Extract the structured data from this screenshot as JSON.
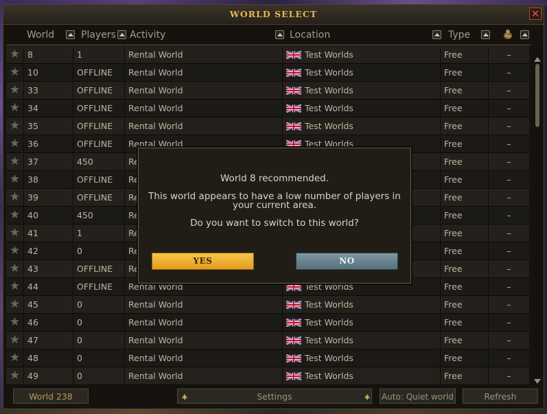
{
  "window": {
    "title": "WORLD SELECT",
    "close_glyph": "✕"
  },
  "columns": {
    "world": "World",
    "players": "Players",
    "activity": "Activity",
    "location": "Location",
    "type": "Type",
    "members_icon": "members-icon"
  },
  "rows": [
    {
      "world": "8",
      "players": "1",
      "activity": "Rental World",
      "location": "Test Worlds",
      "type": "Free",
      "members": "–"
    },
    {
      "world": "10",
      "players": "OFFLINE",
      "activity": "Rental World",
      "location": "Test Worlds",
      "type": "Free",
      "members": "–"
    },
    {
      "world": "33",
      "players": "OFFLINE",
      "activity": "Rental World",
      "location": "Test Worlds",
      "type": "Free",
      "members": "–"
    },
    {
      "world": "34",
      "players": "OFFLINE",
      "activity": "Rental World",
      "location": "Test Worlds",
      "type": "Free",
      "members": "–"
    },
    {
      "world": "35",
      "players": "OFFLINE",
      "activity": "Rental World",
      "location": "Test Worlds",
      "type": "Free",
      "members": "–"
    },
    {
      "world": "36",
      "players": "OFFLINE",
      "activity": "Rental World",
      "location": "Test Worlds",
      "type": "Free",
      "members": "–"
    },
    {
      "world": "37",
      "players": "450",
      "activity": "Re",
      "location": "",
      "type": "Free",
      "members": "–"
    },
    {
      "world": "38",
      "players": "OFFLINE",
      "activity": "Re",
      "location": "",
      "type": "Free",
      "members": "–"
    },
    {
      "world": "39",
      "players": "OFFLINE",
      "activity": "Re",
      "location": "",
      "type": "Free",
      "members": "–"
    },
    {
      "world": "40",
      "players": "450",
      "activity": "Re",
      "location": "",
      "type": "Free",
      "members": "–"
    },
    {
      "world": "41",
      "players": "1",
      "activity": "Re",
      "location": "",
      "type": "Free",
      "members": "–"
    },
    {
      "world": "42",
      "players": "0",
      "activity": "Re",
      "location": "",
      "type": "Free",
      "members": "–"
    },
    {
      "world": "43",
      "players": "OFFLINE",
      "activity": "Re",
      "location": "",
      "type": "Free",
      "members": "–"
    },
    {
      "world": "44",
      "players": "OFFLINE",
      "activity": "Rental World",
      "location": "Test Worlds",
      "type": "Free",
      "members": "–"
    },
    {
      "world": "45",
      "players": "0",
      "activity": "Rental World",
      "location": "Test Worlds",
      "type": "Free",
      "members": "–"
    },
    {
      "world": "46",
      "players": "0",
      "activity": "Rental World",
      "location": "Test Worlds",
      "type": "Free",
      "members": "–"
    },
    {
      "world": "47",
      "players": "0",
      "activity": "Rental World",
      "location": "Test Worlds",
      "type": "Free",
      "members": "–"
    },
    {
      "world": "48",
      "players": "0",
      "activity": "Rental World",
      "location": "Test Worlds",
      "type": "Free",
      "members": "–"
    },
    {
      "world": "49",
      "players": "0",
      "activity": "Rental World",
      "location": "Test Worlds",
      "type": "Free",
      "members": "–"
    }
  ],
  "footer": {
    "current_world": "World 238",
    "settings_label": "Settings",
    "auto_label": "Auto: Quiet world",
    "refresh_label": "Refresh"
  },
  "dialog": {
    "line1": "World 8 recommended.",
    "line2": "This world appears to have a low number of players in",
    "line3": "your current area.",
    "line4": "Do you want to switch to this world?",
    "yes_label": "YES",
    "no_label": "NO"
  },
  "icons": {
    "favourite": "star-icon",
    "flag": "uk-flag-icon",
    "sort": "sort-arrow-icon",
    "scroll_up": "scroll-up-arrow-icon",
    "scroll_down": "scroll-down-arrow-icon"
  },
  "colors": {
    "title": "#e7b949",
    "yes_button": "#f0b534",
    "no_button": "#6d8893",
    "close_button": "#e5513a"
  }
}
